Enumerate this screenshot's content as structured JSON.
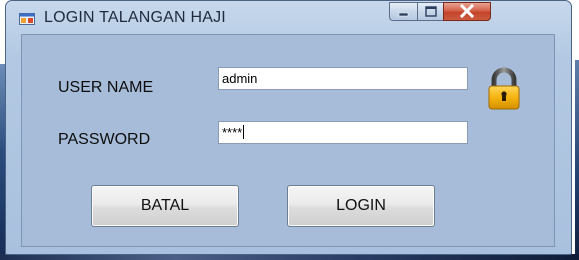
{
  "window": {
    "title": "LOGIN TALANGAN HAJI",
    "controls": {
      "minimize": "minimize",
      "maximize": "maximize",
      "close": "close"
    }
  },
  "form": {
    "username_label": "USER NAME",
    "username_value": "admin",
    "password_label": "PASSWORD",
    "password_value": "****",
    "lock_icon": "padlock-icon"
  },
  "buttons": {
    "cancel_label": "BATAL",
    "login_label": "LOGIN"
  },
  "colors": {
    "client_background": "#a6bcd8",
    "close_button": "#c3442b",
    "lock_body": "#f5b40f"
  }
}
